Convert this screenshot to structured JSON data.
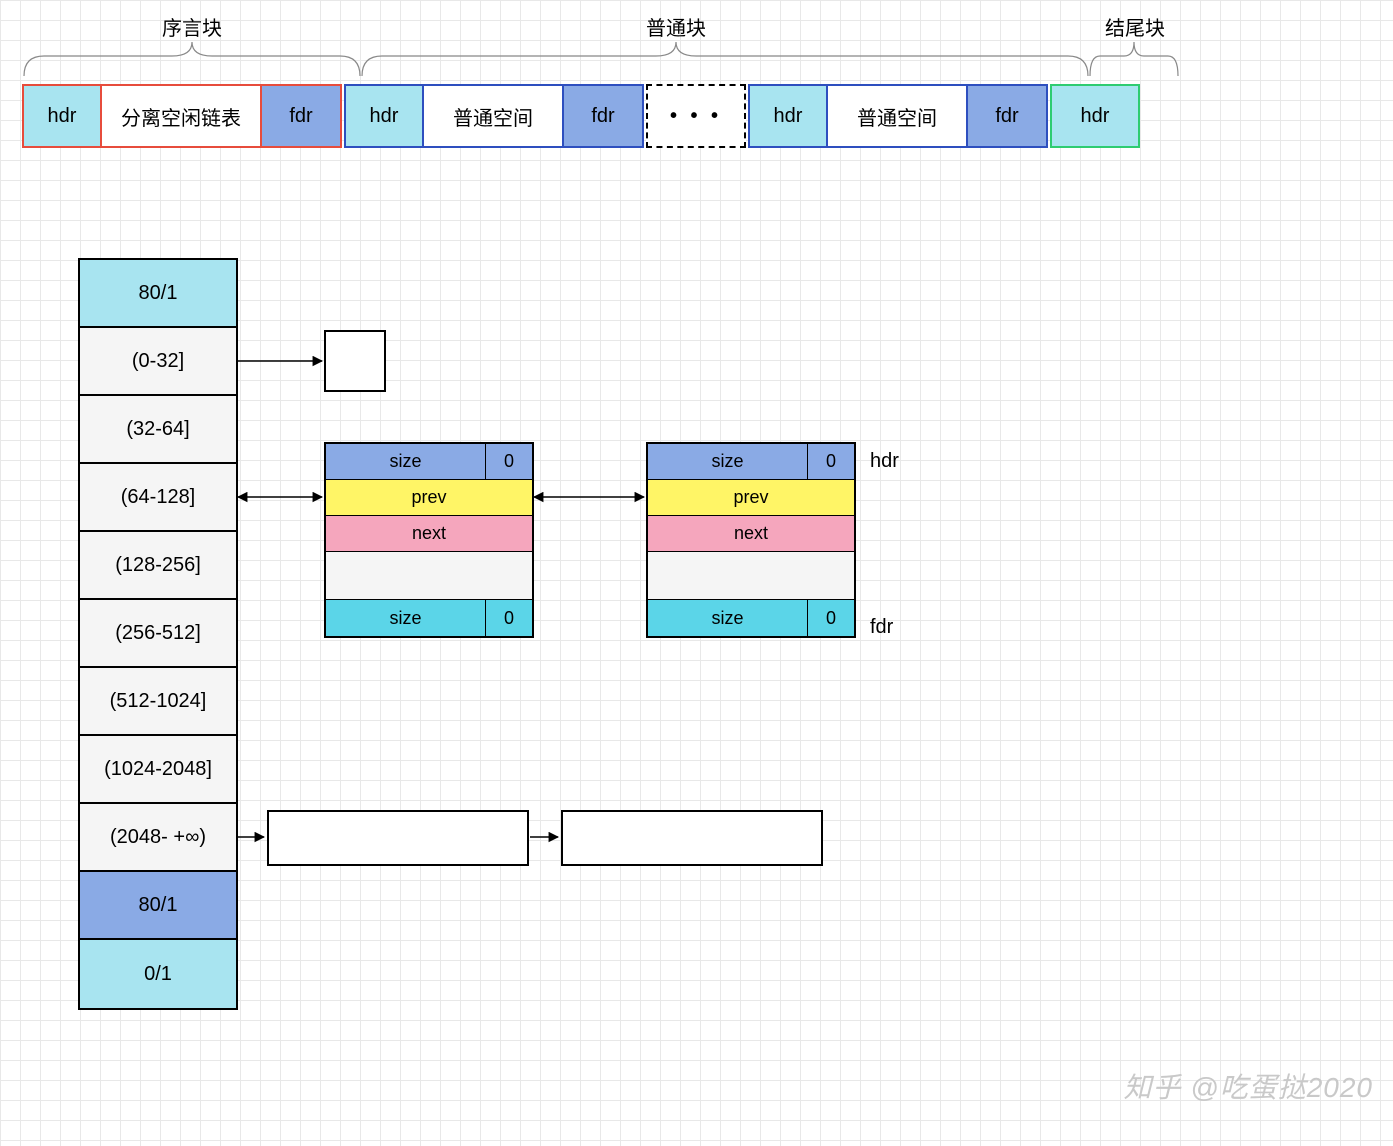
{
  "top_labels": {
    "prologue": "序言块",
    "normal": "普通块",
    "epilogue": "结尾块"
  },
  "top_row": {
    "prologue": {
      "hdr": "hdr",
      "payload": "分离空闲链表",
      "fdr": "fdr"
    },
    "block1": {
      "hdr": "hdr",
      "payload": "普通空间",
      "fdr": "fdr"
    },
    "ellipsis": "• • •",
    "block2": {
      "hdr": "hdr",
      "payload": "普通空间",
      "fdr": "fdr"
    },
    "epilogue": {
      "hdr": "hdr"
    }
  },
  "free_list": {
    "header": "80/1",
    "buckets": [
      "(0-32]",
      "(32-64]",
      "(64-128]",
      "(128-256]",
      "(256-512]",
      "(512-1024]",
      "(1024-2048]",
      "(2048- +∞)"
    ],
    "footer": "80/1",
    "epilogue": "0/1"
  },
  "node": {
    "size_label": "size",
    "alloc_bit": "0",
    "prev": "prev",
    "next": "next"
  },
  "node_side_labels": {
    "hdr": "hdr",
    "fdr": "fdr"
  },
  "watermark": "知乎 @吃蛋挞2020"
}
